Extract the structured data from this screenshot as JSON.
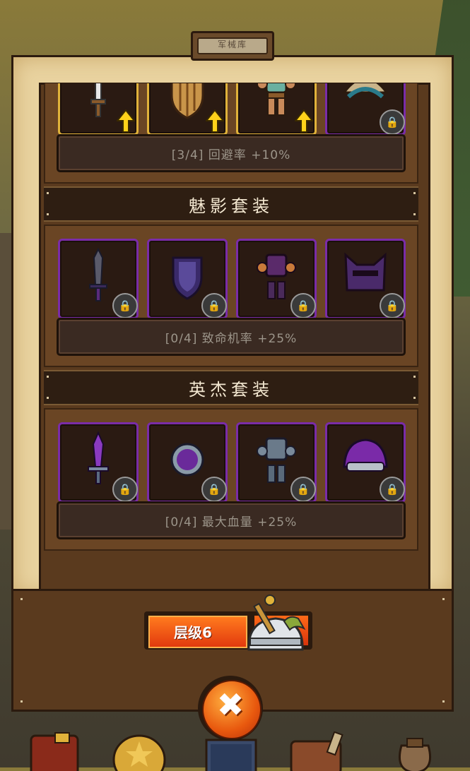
{
  "window": {
    "title": "军械库"
  },
  "sets": [
    {
      "name": "",
      "bonus": "[3/4] 回避率 +10%",
      "items": [
        {
          "icon": "dagger-icon",
          "state": "upgrade"
        },
        {
          "icon": "wooden-shield-icon",
          "state": "upgrade"
        },
        {
          "icon": "leather-armor-icon",
          "state": "upgrade"
        },
        {
          "icon": "feather-helmet-icon",
          "state": "locked"
        }
      ]
    },
    {
      "name": "魅影套装",
      "bonus": "[0/4] 致命机率 +25%",
      "items": [
        {
          "icon": "dark-sword-icon",
          "state": "locked"
        },
        {
          "icon": "purple-shield-icon",
          "state": "locked"
        },
        {
          "icon": "purple-armor-icon",
          "state": "locked"
        },
        {
          "icon": "cat-hood-icon",
          "state": "locked"
        }
      ]
    },
    {
      "name": "英杰套装",
      "bonus": "[0/4] 最大血量 +25%",
      "items": [
        {
          "icon": "crystal-sword-icon",
          "state": "locked"
        },
        {
          "icon": "orb-shield-icon",
          "state": "locked"
        },
        {
          "icon": "steel-armor-icon",
          "state": "locked"
        },
        {
          "icon": "purple-helmet-icon",
          "state": "locked"
        }
      ]
    }
  ],
  "level": {
    "label": "层级6",
    "progress": 0.6
  },
  "colors": {
    "slot_border_rare": "#7a2ca8",
    "slot_border_gold": "#e0b23a",
    "button": "#ff6a18"
  },
  "tabs": [
    "book-icon",
    "gold-coin-icon",
    "armory-icon",
    "treasure-chest-icon",
    "loot-bag-icon"
  ]
}
